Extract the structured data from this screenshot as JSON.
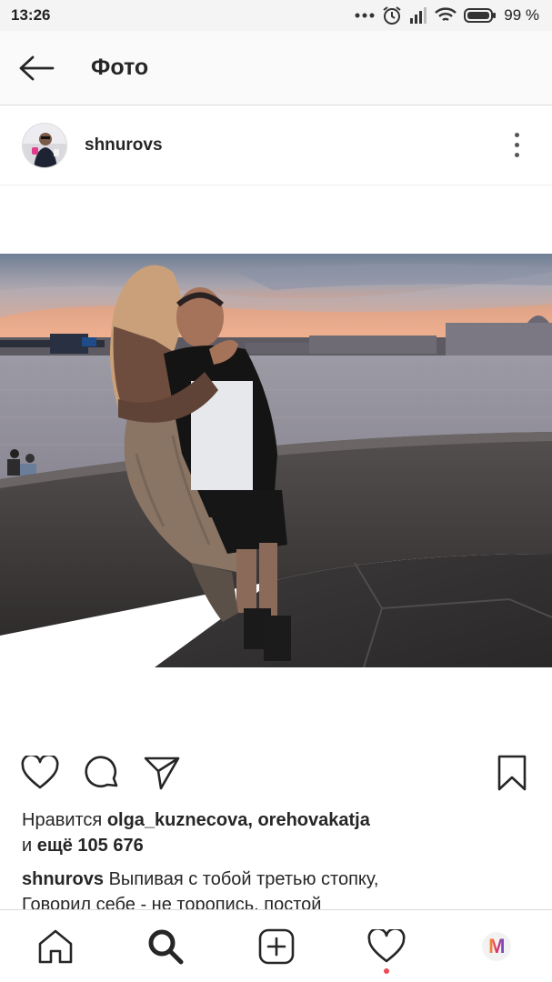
{
  "status_bar": {
    "time": "13:26",
    "battery": "99 %",
    "icons": [
      "more-dots-icon",
      "alarm-icon",
      "signal-icon",
      "wifi-icon",
      "battery-icon"
    ]
  },
  "app_bar": {
    "back_icon": "arrow-left-icon",
    "title": "Фото"
  },
  "post": {
    "username": "shnurovs",
    "more_icon": "vertical-dots-icon",
    "photo_icon": "photo-couple-at-river-sunset"
  },
  "actions": {
    "icons": [
      "heart-icon",
      "comment-icon",
      "share-icon",
      "bookmark-icon"
    ]
  },
  "likes": {
    "prefix": "Нравится ",
    "user1": "olga_kuznecova",
    "separator": ", ",
    "user2": "orehovakatja",
    "and": "и ",
    "more": "ещё 105 676"
  },
  "caption": {
    "username": "shnurovs",
    "line1": " Выпивая с тобой третью стопку,",
    "line2": "Говорил себе - не торопись, постой"
  },
  "bottom_nav": {
    "items": [
      "home-icon",
      "search-icon",
      "new-post-icon",
      "activity-icon",
      "profile-icon"
    ],
    "profile_letter": "M"
  },
  "colors": {
    "accent_red": "#ed4956",
    "text": "#262626",
    "border": "#dbdbdb"
  }
}
